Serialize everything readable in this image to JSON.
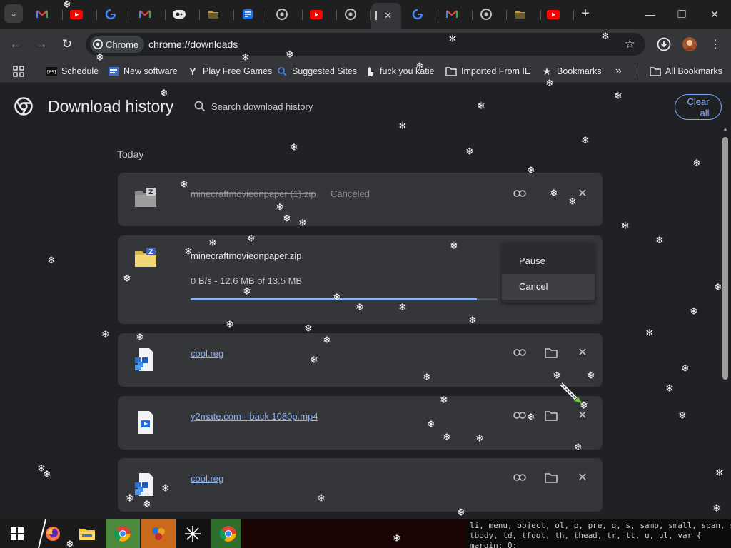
{
  "window": {
    "new_tab_label": "+",
    "minimize_label": "—",
    "maximize_label": "❐",
    "close_label": "✕"
  },
  "tabs": [
    {
      "icon": "gmail-icon"
    },
    {
      "icon": "youtube-icon"
    },
    {
      "icon": "google-icon"
    },
    {
      "icon": "gmail-icon"
    },
    {
      "icon": "circle-logo-icon"
    },
    {
      "icon": "folder-icon"
    },
    {
      "icon": "blue-app-icon"
    },
    {
      "icon": "chrome-icon"
    },
    {
      "icon": "youtube-icon"
    },
    {
      "icon": "chrome-icon"
    },
    {
      "icon": "downloads-page-icon",
      "active": true
    },
    {
      "icon": "google-icon"
    },
    {
      "icon": "gmail-icon"
    },
    {
      "icon": "chrome-icon"
    },
    {
      "icon": "folder-icon"
    },
    {
      "icon": "youtube-icon"
    }
  ],
  "toolbar": {
    "chip_label": "Chrome",
    "url": "chrome://downloads"
  },
  "bookmarks": {
    "items": [
      {
        "label": "Schedule",
        "icon": "schedule-icon"
      },
      {
        "label": "New software",
        "icon": "software-icon"
      },
      {
        "label": "Play Free Games",
        "icon": "games-icon"
      },
      {
        "label": "Suggested Sites",
        "icon": "suggested-sites-icon"
      },
      {
        "label": "fuck you katie",
        "icon": "hand-icon"
      },
      {
        "label": "Imported From IE",
        "icon": "folder-icon"
      },
      {
        "label": "Bookmarks",
        "icon": "star-icon"
      }
    ],
    "overflow_label": "»",
    "all_bookmarks_label": "All Bookmarks"
  },
  "page": {
    "title": "Download history",
    "search_placeholder": "Search download history",
    "clear_all_line1": "Clear",
    "clear_all_line2": "all",
    "section_label": "Today"
  },
  "downloads": [
    {
      "filename": "minecraftmovieonpaper (1).zip",
      "status": "Canceled",
      "icon": "zip-icon-gray"
    },
    {
      "filename": "minecraftmovieonpaper.zip",
      "progress_text": "0 B/s - 12.6 MB of 13.5 MB",
      "progress": 0.933,
      "icon": "zip-icon-yellow",
      "menu": {
        "pause_label": "Pause",
        "cancel_label": "Cancel"
      }
    },
    {
      "filename": "cool.reg",
      "icon": "registry-icon"
    },
    {
      "filename": "y2mate.com - back 1080p.mp4",
      "icon": "video-file-icon"
    },
    {
      "filename": "cool.reg",
      "icon": "registry-icon"
    }
  ],
  "terminal": {
    "line1": "li, menu, object, ol, p, pre, q, s, samp, small, span, s",
    "line2": "tbody, td, tfoot, th, thead, tr, tt, u, ul, var {",
    "line3": "  margin: 0;"
  },
  "colors": {
    "accent": "#8ab4f8",
    "page_bg": "#202124",
    "card_bg": "#35363a"
  }
}
